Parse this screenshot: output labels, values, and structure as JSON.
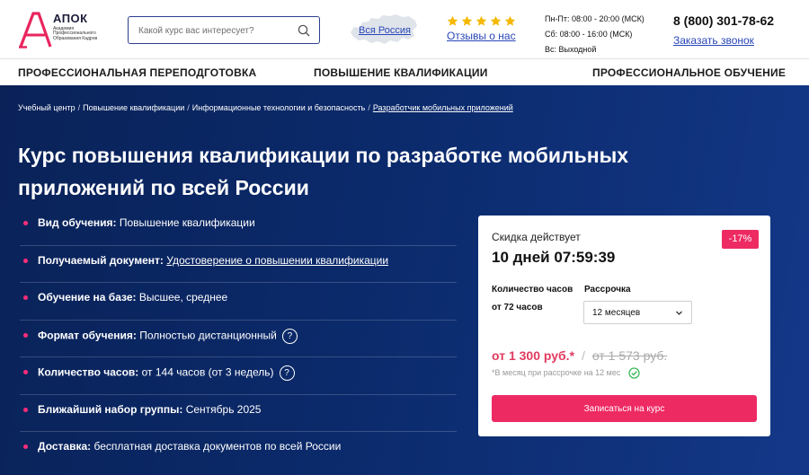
{
  "header": {
    "logo_name": "АПОК",
    "logo_subtitle": "Академия Профессионального Образования Кадров",
    "search_placeholder": "Какой курс вас интересует?",
    "region_link": "Вся Россия",
    "reviews_link": "Отзывы о нас",
    "rating_stars": 5,
    "star_color": "#f5b800",
    "schedule": [
      "Пн-Пт: 08:00 - 20:00 (МСК)",
      "Сб: 08:00 - 16:00 (МСК)",
      "Вс: Выходной"
    ],
    "phone": "8 (800) 301-78-62",
    "callback_link": "Заказать звонок"
  },
  "nav": {
    "items": [
      "ПРОФЕССИОНАЛЬНАЯ ПЕРЕПОДГОТОВКА",
      "ПОВЫШЕНИЕ КВАЛИФИКАЦИИ",
      "ПРОФЕССИОНАЛЬНОЕ ОБУЧЕНИЕ"
    ]
  },
  "breadcrumb": {
    "items": [
      "Учебный центр",
      "Повышение квалификации",
      "Информационные технологии и безопасность",
      "Разработчик мобильных приложений"
    ],
    "separator": "/"
  },
  "page_title": "Курс повышения квалификации по разработке мобильных приложений по всей России",
  "features": [
    {
      "label": "Вид обучения:",
      "value": "Повышение квалификации"
    },
    {
      "label": "Получаемый документ:",
      "value": "Удостоверение о повышении квалификации"
    },
    {
      "label": "Обучение на базе:",
      "value": "Высшее, среднее"
    },
    {
      "label": "Формат обучения:",
      "value": "Полностью дистанционный"
    },
    {
      "label": "Количество часов:",
      "value": "от 144 часов (от 3 недель)"
    },
    {
      "label": "Ближайший набор группы:",
      "value": "Сентябрь 2025"
    },
    {
      "label": "Доставка:",
      "value": "бесплатная доставка документов по всей России"
    }
  ],
  "help_symbol": "?",
  "card": {
    "discount_label": "Скидка действует",
    "discount_badge": "-17%",
    "timer": "10 дней 07:59:39",
    "hours_label": "Количество часов",
    "hours_value": "от 72 часов",
    "installment_label": "Рассрочка",
    "installment_value": "12 месяцев",
    "price_new": "от 1 300 руб.*",
    "price_separator": "/",
    "price_old": "от 1 573 руб.",
    "price_note": "*В месяц при рассрочке на 12 мес",
    "enroll_button": "Записаться на курс"
  },
  "colors": {
    "accent": "#ee2a63",
    "hero_bg": "#0b2a6b",
    "link": "#2946b8"
  }
}
